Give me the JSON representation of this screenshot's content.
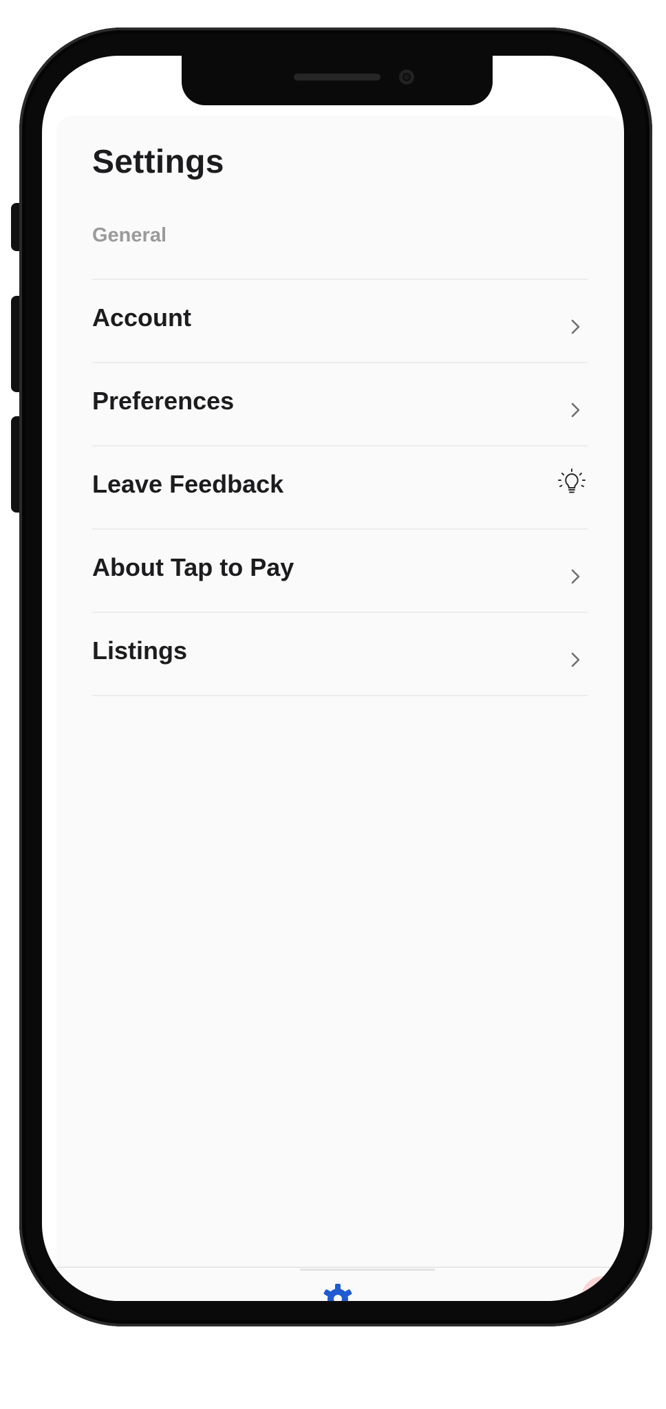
{
  "page": {
    "title": "Settings"
  },
  "section": {
    "header": "General"
  },
  "menu": {
    "items": [
      {
        "label": "Account",
        "icon": "chevron-right-icon"
      },
      {
        "label": "Preferences",
        "icon": "chevron-right-icon"
      },
      {
        "label": "Leave Feedback",
        "icon": "lightbulb-icon"
      },
      {
        "label": "About Tap to Pay",
        "icon": "chevron-right-icon"
      },
      {
        "label": "Listings",
        "icon": "chevron-right-icon"
      }
    ]
  },
  "tab_bar": {
    "active_tab_icon": "gear-icon",
    "tools_icon": "wrench-screwdriver-icon"
  },
  "colors": {
    "accent": "#1f5bd1",
    "text": "#1c1c1e",
    "section_header": "#9a9a9a",
    "divider": "#ececec",
    "tools_bg": "#f9d6d6",
    "background": "#fafafa"
  }
}
